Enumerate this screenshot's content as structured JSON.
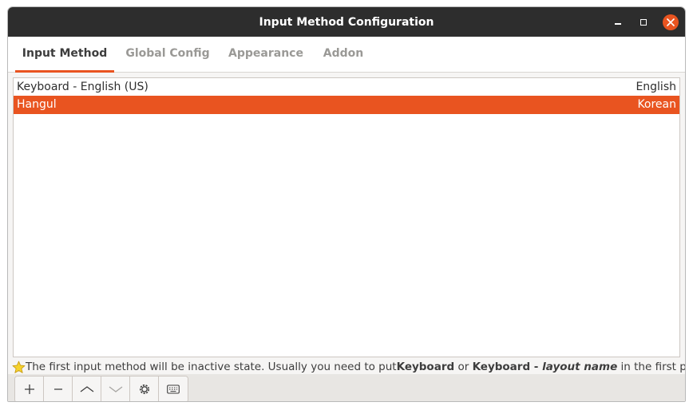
{
  "window": {
    "title": "Input Method Configuration",
    "controls": [
      "minimize-icon",
      "maximize-icon",
      "close-icon"
    ]
  },
  "tabs": [
    {
      "label": "Input Method",
      "active": true
    },
    {
      "label": "Global Config",
      "active": false
    },
    {
      "label": "Appearance",
      "active": false
    },
    {
      "label": "Addon",
      "active": false
    }
  ],
  "input_methods": [
    {
      "name": "Keyboard - English (US)",
      "language": "English",
      "selected": false
    },
    {
      "name": "Hangul",
      "language": "Korean",
      "selected": true
    }
  ],
  "hint": {
    "icon": "star-icon",
    "part1": "The first input method will be inactive state. Usually you need to put ",
    "keyword1": "Keyboard",
    "part2": " or ",
    "keyword2": "Keyboard - ",
    "keyword2_italic": "layout name",
    "part3": " in the first place."
  },
  "toolbar": {
    "buttons": [
      "add-icon",
      "remove-icon",
      "move-up-icon",
      "move-down-icon",
      "configure-icon",
      "keyboard-layout-icon"
    ]
  },
  "colors": {
    "accent": "#e95420",
    "titlebar": "#2d2d2d",
    "inactive_tab": "#9a9996"
  }
}
